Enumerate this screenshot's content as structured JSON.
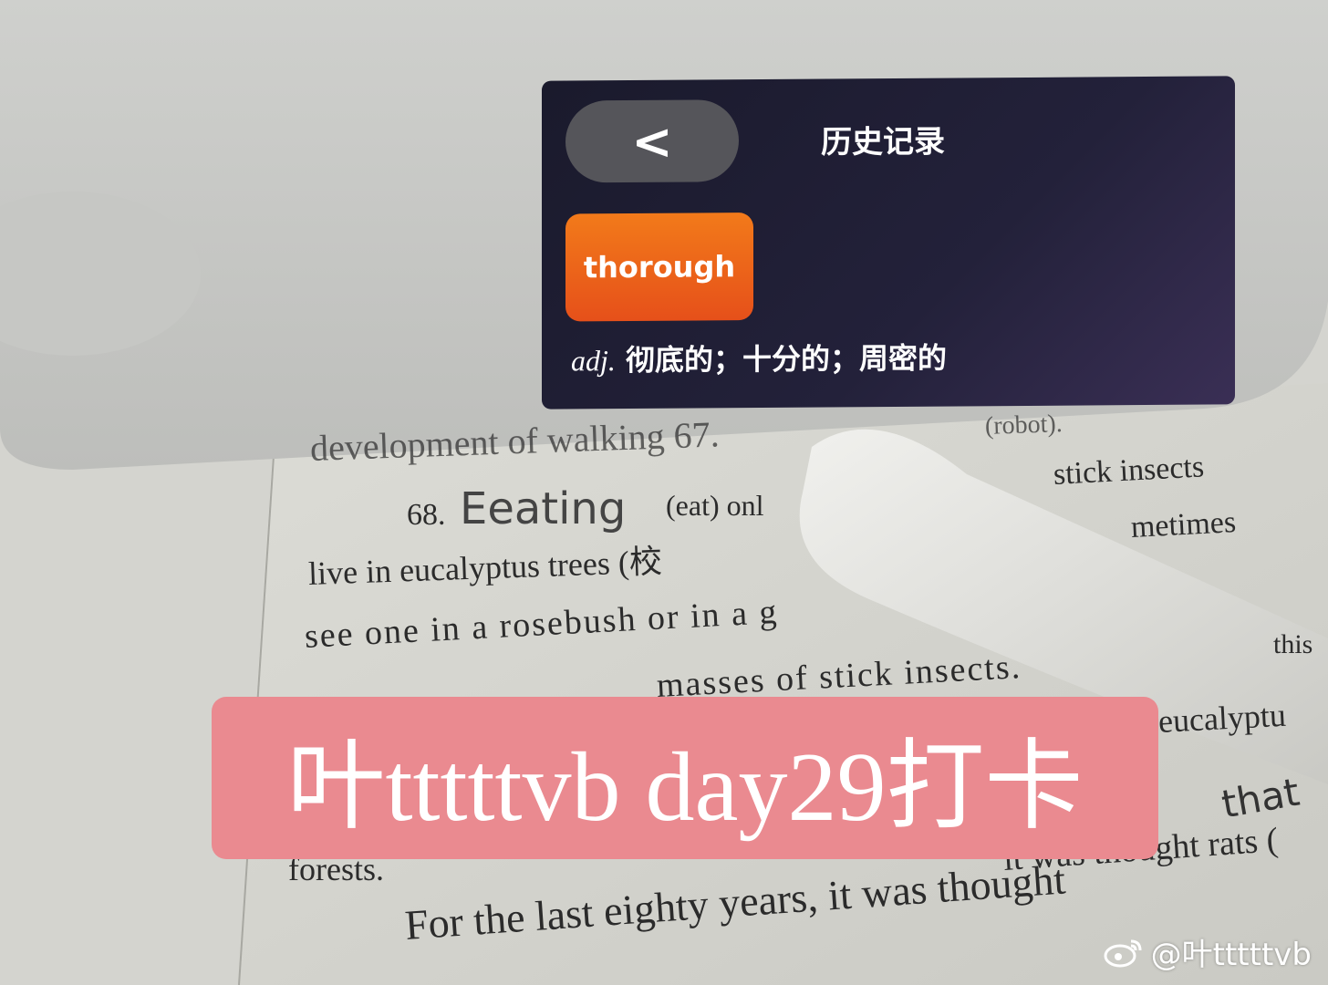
{
  "device_screen": {
    "back_icon": "chevron-left-icon",
    "back_glyph": "<",
    "title": "历史记录",
    "word": "thorough",
    "definition_pos": "adj.",
    "definition_text": "彻底的；十分的；周密的"
  },
  "paper": {
    "line_1": "development of walking 67.",
    "line_1_right": "(robot).",
    "question_number": "68.",
    "handwritten_answer": "Eeating",
    "line_2_rest": "(eat) onl",
    "line_2_right": "stick insects",
    "line_3_right": "metimes",
    "line_4": "live in eucalyptus trees (校",
    "line_5": "see one in a rosebush or in a g",
    "line_5_right": "this",
    "line_6": "masses of stick insects.",
    "line_6_right": "eucalyptu",
    "handwritten_note": "that",
    "line_7": "forests.",
    "line_8_right": "it was thought rats (",
    "line_9": "For the last eighty years, it was thought"
  },
  "banner": {
    "text": "叶tttttvb day29打卡"
  },
  "watermark": {
    "icon": "weibo-icon",
    "text": "@叶tttttvb"
  },
  "colors": {
    "banner_bg": "#ea8a90",
    "word_button": "#ea5f1a",
    "screen_bg": "#1d1b2e"
  }
}
